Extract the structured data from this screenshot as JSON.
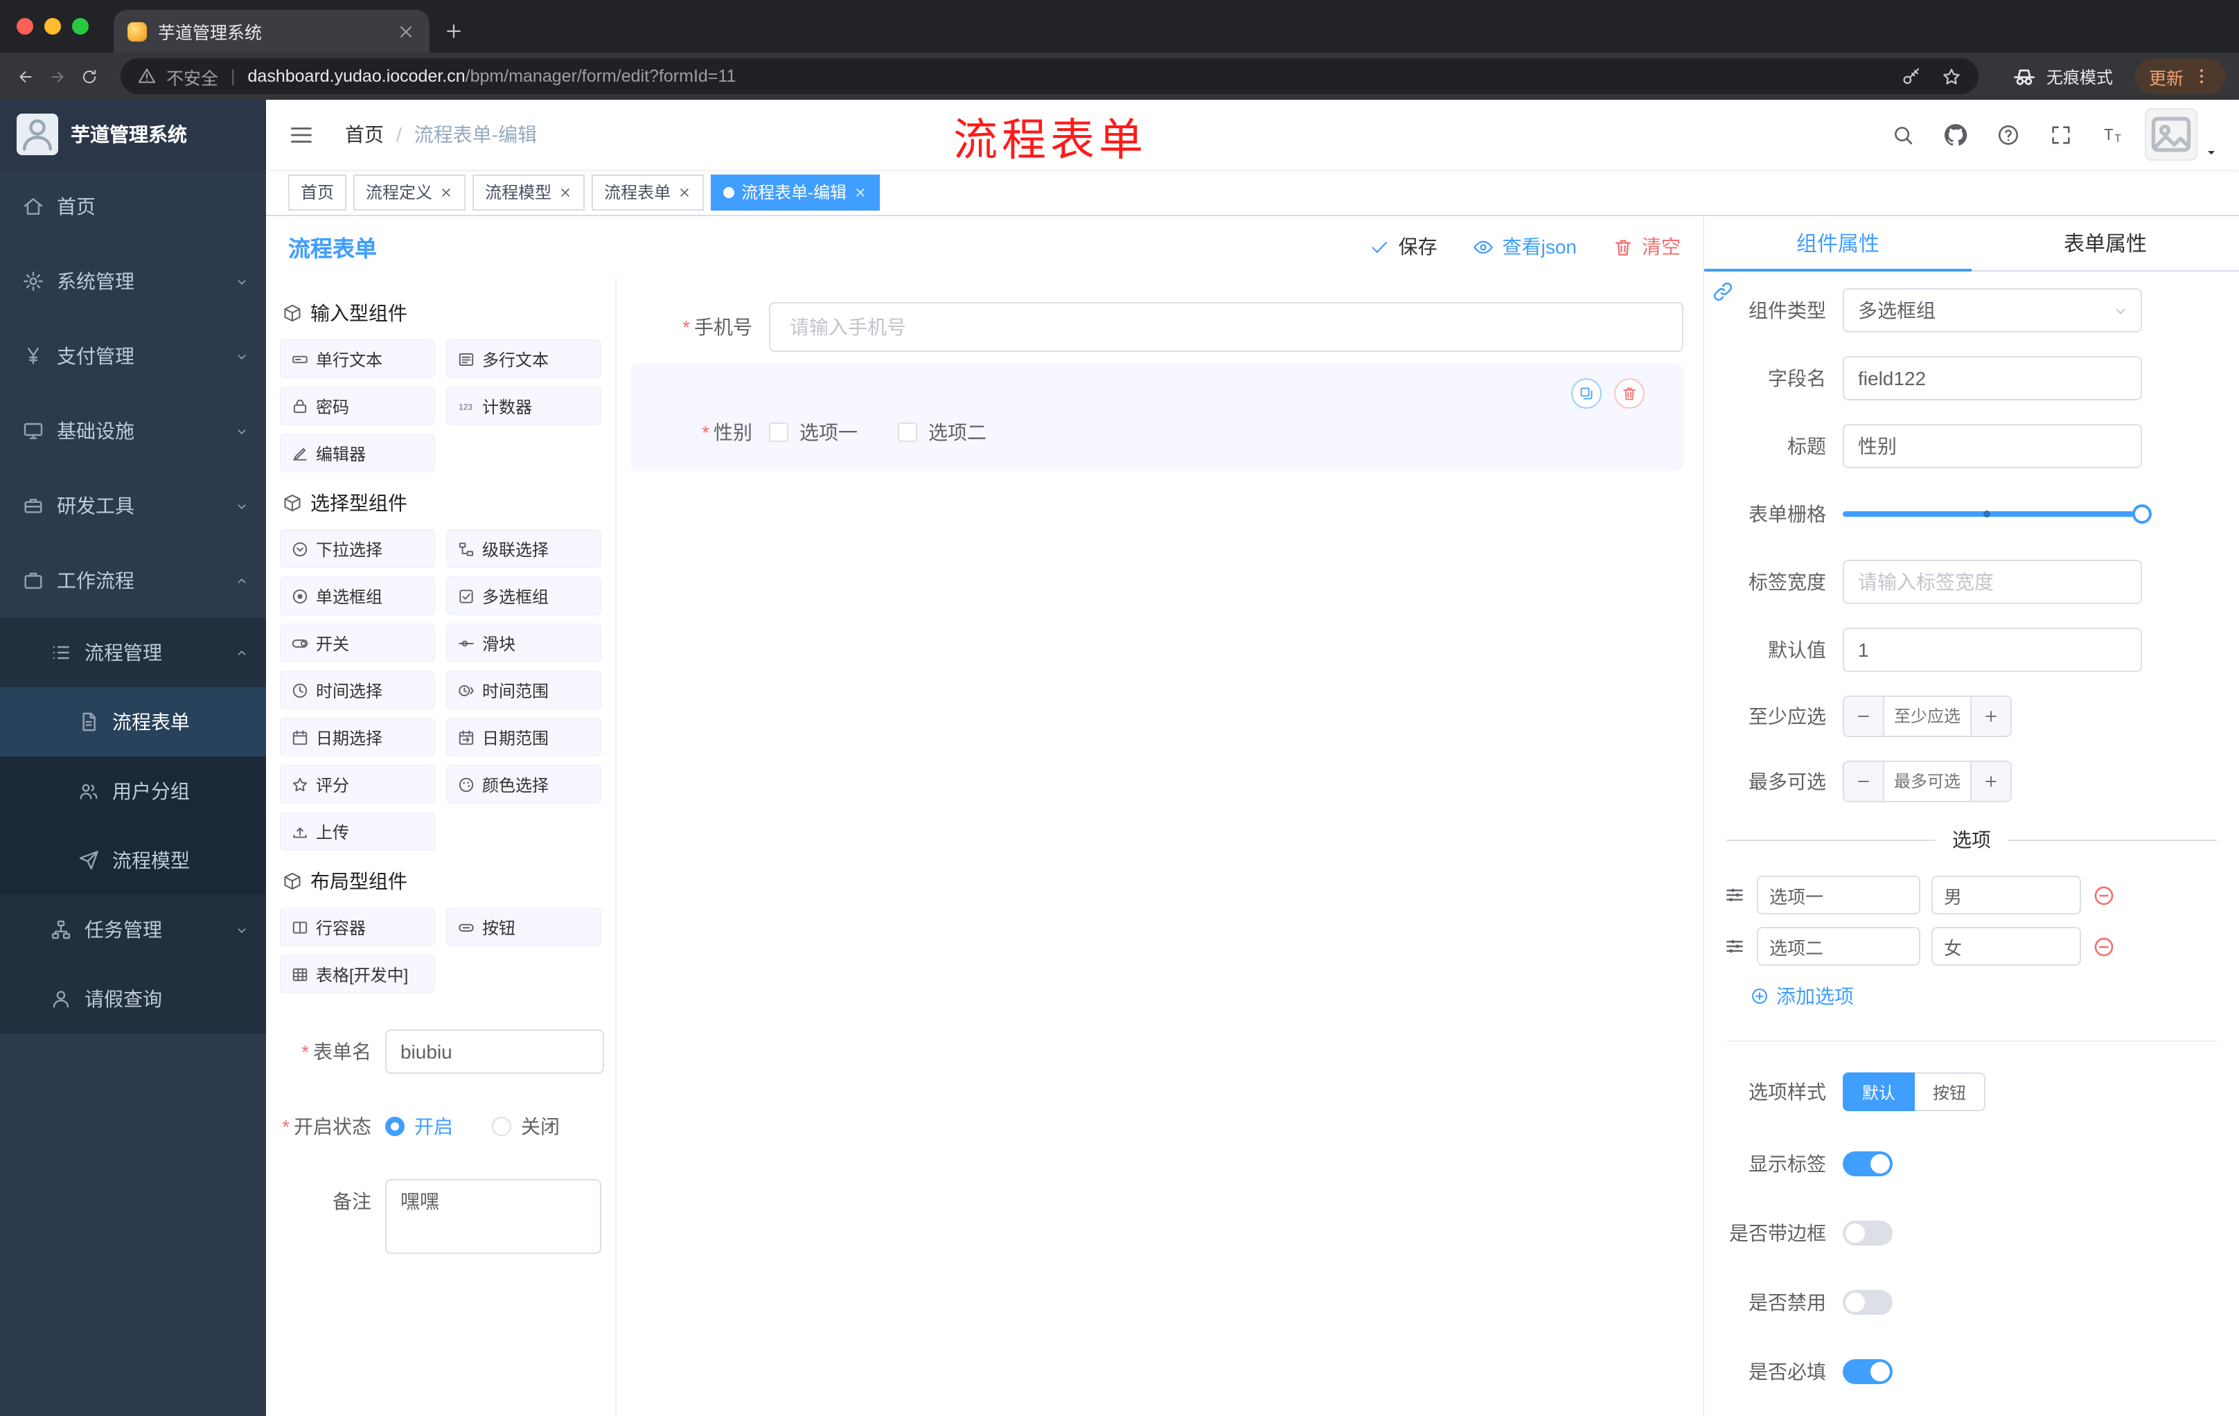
{
  "browser": {
    "tab": {
      "title": "芋道管理系统"
    },
    "address": {
      "security_label": "不安全",
      "url_domain": "dashboard.yudao.iocoder.cn",
      "url_path": "/bpm/manager/form/edit?formId=11",
      "incognito_label": "无痕模式",
      "update_label": "更新"
    }
  },
  "annotation": {
    "text": "流程表单"
  },
  "app": {
    "logo_title": "芋道管理系统",
    "breadcrumb": {
      "home": "首页",
      "sep": "/",
      "current": "流程表单-编辑"
    },
    "tags": [
      {
        "label": "首页",
        "closable": false,
        "active": false
      },
      {
        "label": "流程定义",
        "closable": true,
        "active": false
      },
      {
        "label": "流程模型",
        "closable": true,
        "active": false
      },
      {
        "label": "流程表单",
        "closable": true,
        "active": false
      },
      {
        "label": "流程表单-编辑",
        "closable": true,
        "active": true
      }
    ],
    "sidebar": {
      "items": [
        {
          "label": "首页",
          "icon": "home",
          "level": 1
        },
        {
          "label": "系统管理",
          "icon": "gear",
          "level": 1,
          "chevron": "down"
        },
        {
          "label": "支付管理",
          "icon": "yen",
          "level": 1,
          "chevron": "down"
        },
        {
          "label": "基础设施",
          "icon": "monitor",
          "level": 1,
          "chevron": "down"
        },
        {
          "label": "研发工具",
          "icon": "toolbox",
          "level": 1,
          "chevron": "down"
        },
        {
          "label": "工作流程",
          "icon": "briefcase",
          "level": 1,
          "chevron": "up"
        },
        {
          "label": "流程管理",
          "icon": "list",
          "level": 2,
          "chevron": "up"
        },
        {
          "label": "流程表单",
          "icon": "doc",
          "level": 3,
          "active": true
        },
        {
          "label": "用户分组",
          "icon": "users",
          "level": 3
        },
        {
          "label": "流程模型",
          "icon": "send",
          "level": 3
        },
        {
          "label": "任务管理",
          "icon": "hierarchy",
          "level": 2,
          "chevron": "down"
        },
        {
          "label": "请假查询",
          "icon": "user",
          "level": 2
        }
      ]
    }
  },
  "editor": {
    "title": "流程表单",
    "actions": {
      "save": "保存",
      "view_json": "查看json",
      "clear": "清空"
    },
    "palette": {
      "groups": [
        {
          "title": "输入型组件",
          "icon": "cube",
          "items": [
            {
              "label": "单行文本",
              "icon": "singleline"
            },
            {
              "label": "多行文本",
              "icon": "multiline"
            },
            {
              "label": "密码",
              "icon": "password"
            },
            {
              "label": "计数器",
              "icon": "counter"
            },
            {
              "label": "编辑器",
              "icon": "editor"
            }
          ]
        },
        {
          "title": "选择型组件",
          "icon": "cube",
          "items": [
            {
              "label": "下拉选择",
              "icon": "select"
            },
            {
              "label": "级联选择",
              "icon": "cascader"
            },
            {
              "label": "单选框组",
              "icon": "radio"
            },
            {
              "label": "多选框组",
              "icon": "checkbox"
            },
            {
              "label": "开关",
              "icon": "switch"
            },
            {
              "label": "滑块",
              "icon": "slider"
            },
            {
              "label": "时间选择",
              "icon": "time"
            },
            {
              "label": "时间范围",
              "icon": "timerange"
            },
            {
              "label": "日期选择",
              "icon": "date"
            },
            {
              "label": "日期范围",
              "icon": "daterange"
            },
            {
              "label": "评分",
              "icon": "star"
            },
            {
              "label": "颜色选择",
              "icon": "color"
            },
            {
              "label": "上传",
              "icon": "upload"
            }
          ]
        },
        {
          "title": "布局型组件",
          "icon": "cube",
          "items": [
            {
              "label": "行容器",
              "icon": "row"
            },
            {
              "label": "按钮",
              "icon": "button"
            },
            {
              "label": "表格[开发中]",
              "icon": "table"
            }
          ]
        }
      ]
    },
    "form_meta": {
      "name_label": "表单名",
      "name_value": "biubiu",
      "status_label": "开启状态",
      "status_on": "开启",
      "status_off": "关闭",
      "remark_label": "备注",
      "remark_value": "嘿嘿"
    },
    "canvas": {
      "phone": {
        "label": "手机号",
        "placeholder": "请输入手机号"
      },
      "gender": {
        "label": "性别",
        "options": [
          "选项一",
          "选项二"
        ]
      }
    },
    "props": {
      "tabs": {
        "component": "组件属性",
        "form": "表单属性"
      },
      "component_type": {
        "label": "组件类型",
        "value": "多选框组"
      },
      "field_name": {
        "label": "字段名",
        "value": "field122"
      },
      "title": {
        "label": "标题",
        "value": "性别"
      },
      "grid": {
        "label": "表单栅格"
      },
      "label_width": {
        "label": "标签宽度",
        "placeholder": "请输入标签宽度"
      },
      "default_value": {
        "label": "默认值",
        "value": "1"
      },
      "min_select": {
        "label": "至少应选",
        "placeholder": "至少应选"
      },
      "max_select": {
        "label": "最多可选",
        "placeholder": "最多可选"
      },
      "options_divider": "选项",
      "options": [
        {
          "label": "选项一",
          "value": "男"
        },
        {
          "label": "选项二",
          "value": "女"
        }
      ],
      "add_option": "添加选项",
      "option_style": {
        "label": "选项样式",
        "choices": [
          "默认",
          "按钮"
        ],
        "active": "默认"
      },
      "switches": [
        {
          "label": "显示标签",
          "on": true
        },
        {
          "label": "是否带边框",
          "on": false
        },
        {
          "label": "是否禁用",
          "on": false
        },
        {
          "label": "是否必填",
          "on": true
        }
      ]
    }
  }
}
